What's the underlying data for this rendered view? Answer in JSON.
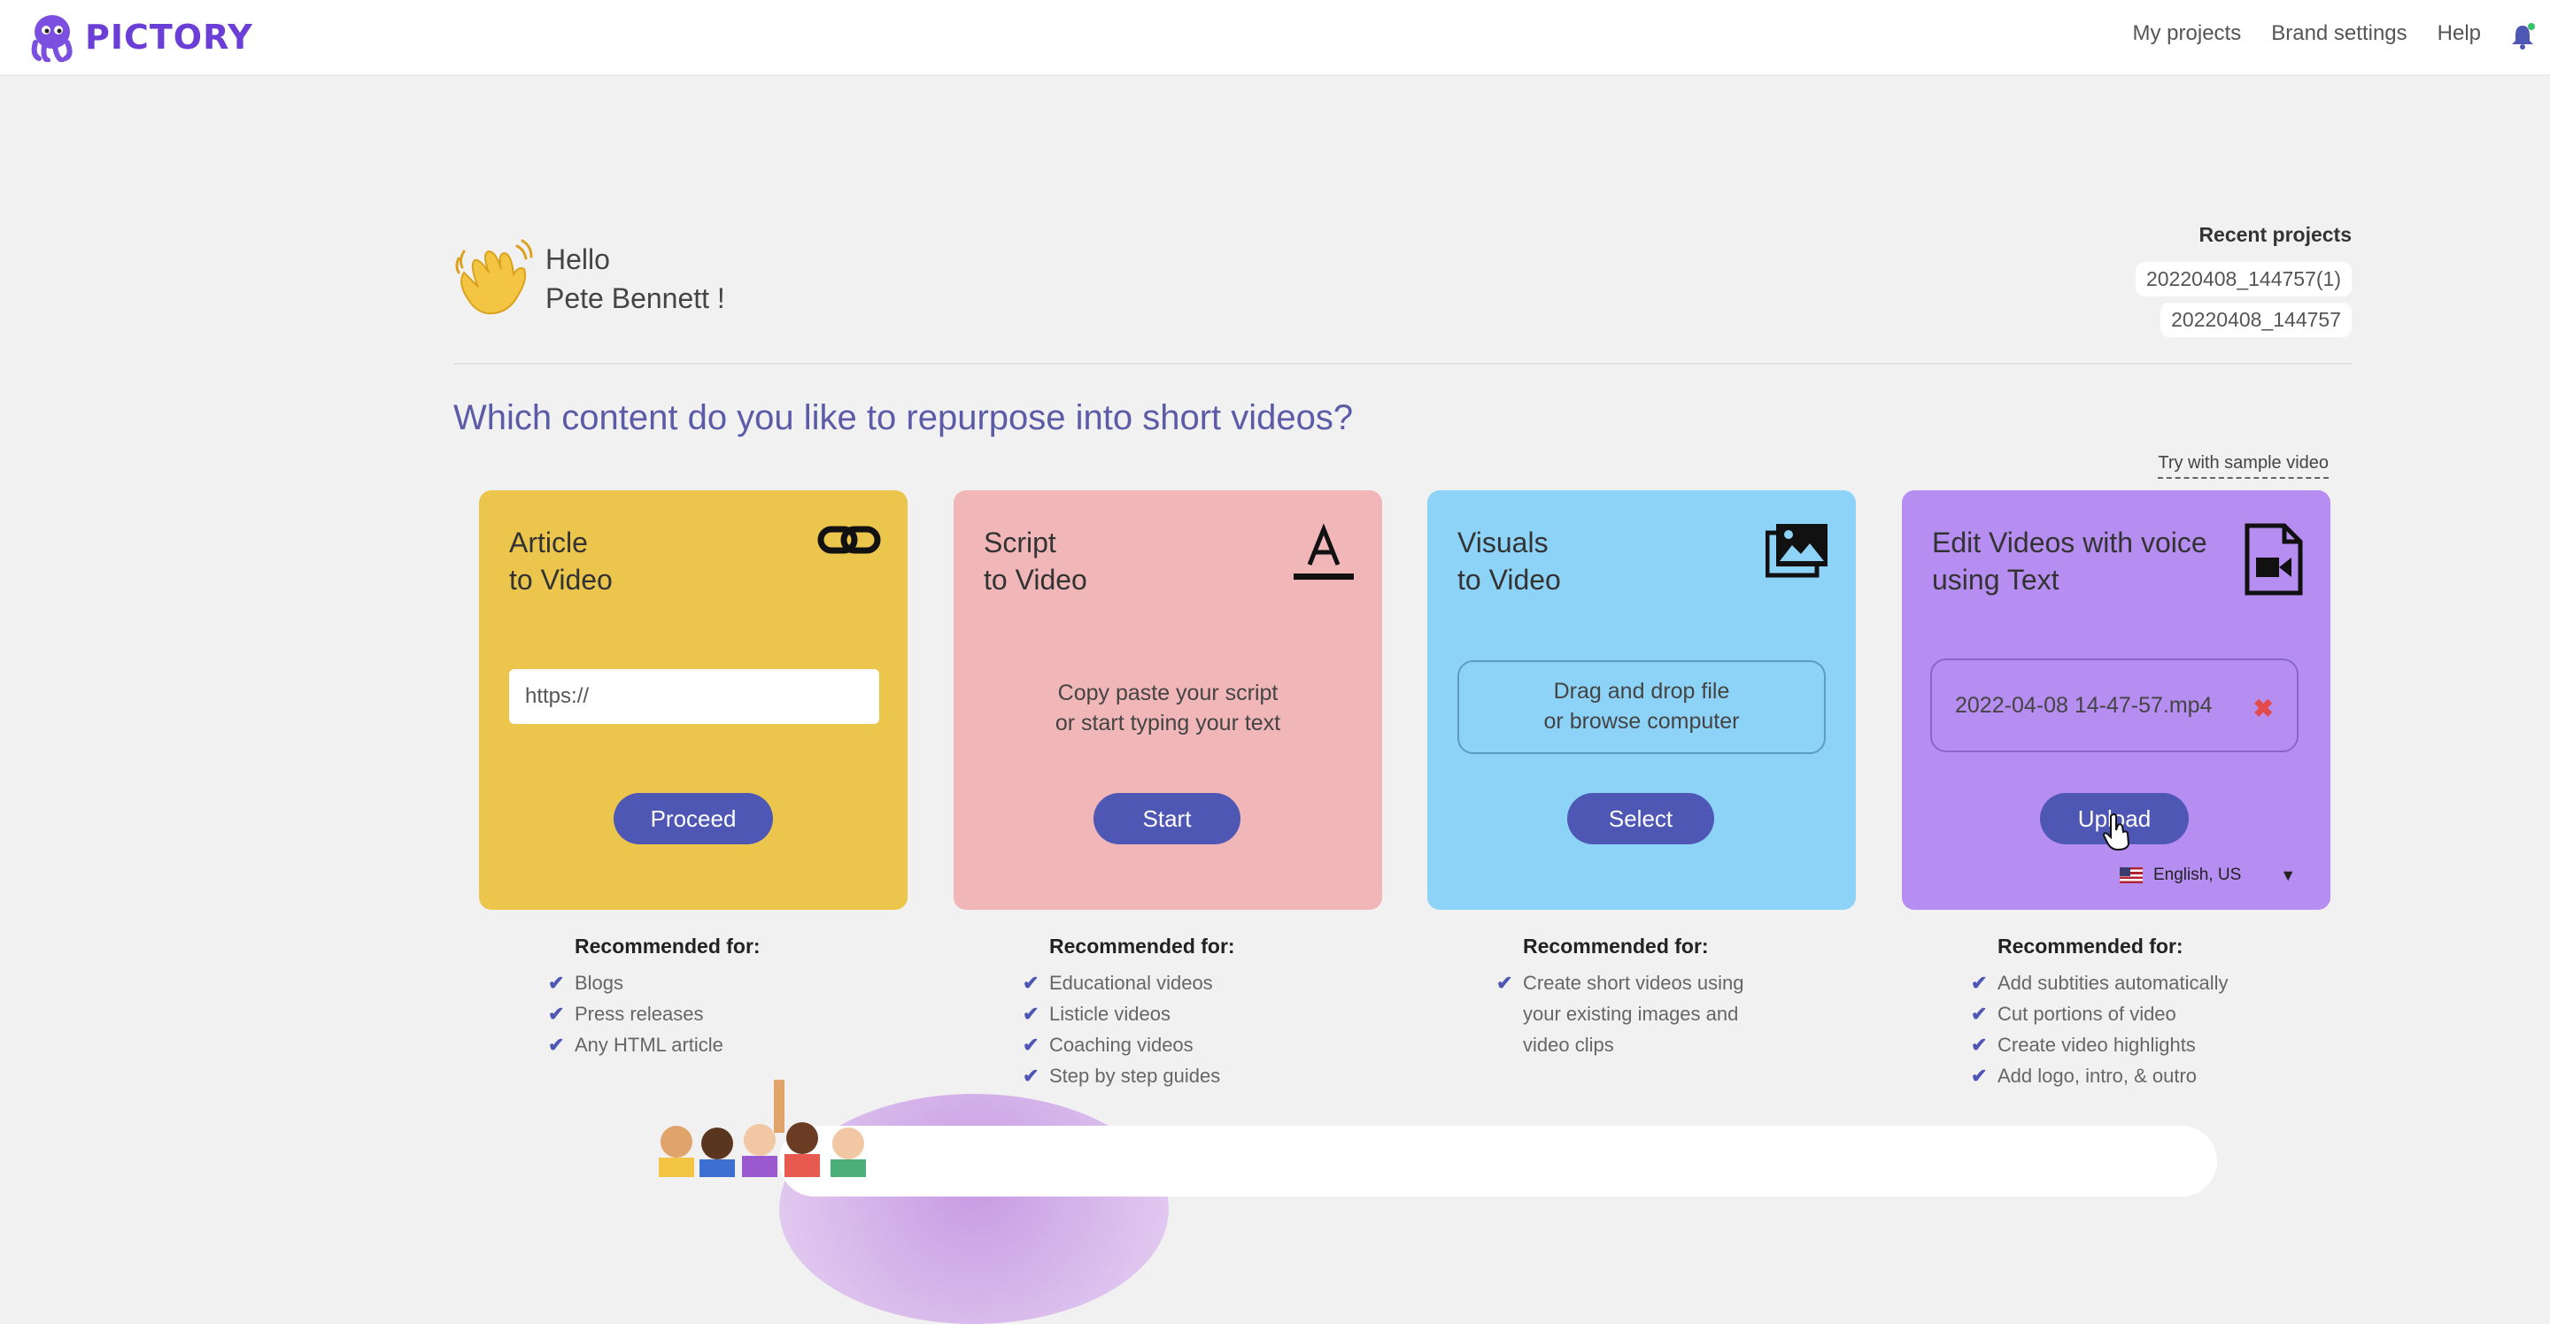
{
  "app": {
    "logo_text": "PICTORY"
  },
  "nav": {
    "my_projects": "My projects",
    "brand_settings": "Brand settings",
    "help": "Help"
  },
  "greeting": {
    "line1": "Hello",
    "line2": "Pete Bennett !"
  },
  "recent": {
    "title": "Recent projects",
    "items": [
      "20220408_144757(1)",
      "20220408_144757"
    ]
  },
  "question": "Which content do you like to repurpose into short videos?",
  "sample_link": "Try with sample video",
  "cards": [
    {
      "title1": "Article",
      "title2": "to Video",
      "placeholder": "https://",
      "button": "Proceed",
      "color": "#ecc54d",
      "icon": "link-icon"
    },
    {
      "title1": "Script",
      "title2": "to Video",
      "text1": "Copy paste your script",
      "text2": "or start typing your text",
      "button": "Start",
      "color": "#f0b6b8",
      "icon": "text-format-icon"
    },
    {
      "title1": "Visuals",
      "title2": "to Video",
      "text1": "Drag and drop file",
      "text2": "or browse computer",
      "button": "Select",
      "color": "#8dd3f8",
      "icon": "images-icon"
    },
    {
      "title1": "Edit Videos with voice",
      "title2": "using Text",
      "file_name": "2022-04-08 14-47-57.mp4",
      "button": "Upload",
      "language": "English, US",
      "color": "#b68df0",
      "icon": "video-file-icon"
    }
  ],
  "recommended": [
    {
      "title": "Recommended for:",
      "items": [
        "Blogs",
        "Press releases",
        "Any HTML article"
      ]
    },
    {
      "title": "Recommended for:",
      "items": [
        "Educational videos",
        "Listicle videos",
        "Coaching videos",
        "Step by step guides"
      ]
    },
    {
      "title": "Recommended for:",
      "items": [
        "Create short videos using",
        "your existing images and",
        "video clips"
      ]
    },
    {
      "title": "Recommended for:",
      "items": [
        "Add subtities automatically",
        "Cut portions of video",
        "Create video highlights",
        "Add logo, intro, & outro"
      ]
    }
  ],
  "colors": {
    "accent": "#4f57b5",
    "brand": "#6b3fd6",
    "question": "#5b5ba7"
  }
}
